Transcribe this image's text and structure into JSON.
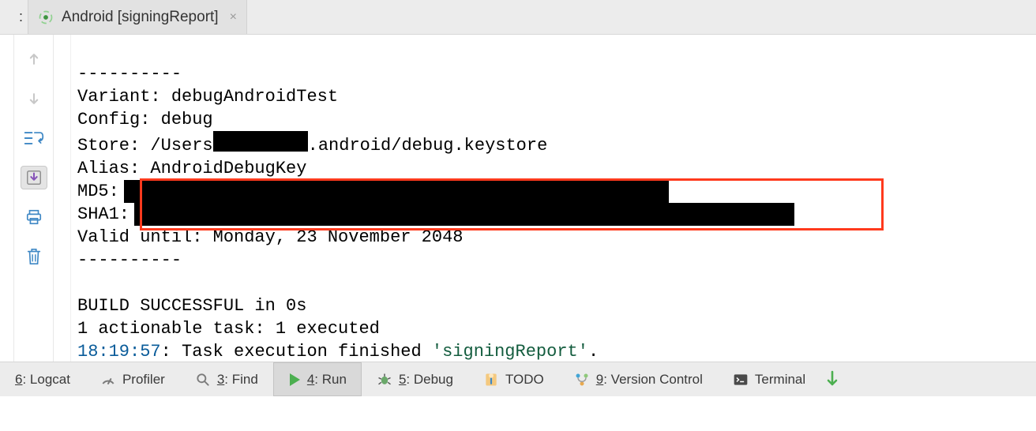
{
  "tab": {
    "prefix": ":",
    "title": "Android [signingReport]",
    "close_glyph": "×"
  },
  "console": {
    "sep": "----------",
    "line_variant": "Variant: debugAndroidTest",
    "line_config": "Config: debug",
    "store_prefix": "Store: /Users",
    "store_suffix": ".android/debug.keystore",
    "line_alias": "Alias: AndroidDebugKey",
    "md5_label": "MD5:",
    "sha1_label": "SHA1:",
    "line_valid": "Valid until: Monday, 23 November 2048",
    "line_build": "BUILD SUCCESSFUL in 0s",
    "line_tasks": "1 actionable task: 1 executed",
    "timestamp": "18:19:57",
    "finish_mid": ": Task execution finished ",
    "finish_quoted": "'signingReport'",
    "finish_end": "."
  },
  "toolWindows": {
    "logcat_num": "6",
    "logcat": ": Logcat",
    "profiler": "Profiler",
    "find_num": "3",
    "find": ": Find",
    "run_num": "4",
    "run": ": Run",
    "debug_num": "5",
    "debug": ": Debug",
    "todo": "TODO",
    "vc_num": "9",
    "vc": ": Version Control",
    "terminal": "Terminal"
  }
}
